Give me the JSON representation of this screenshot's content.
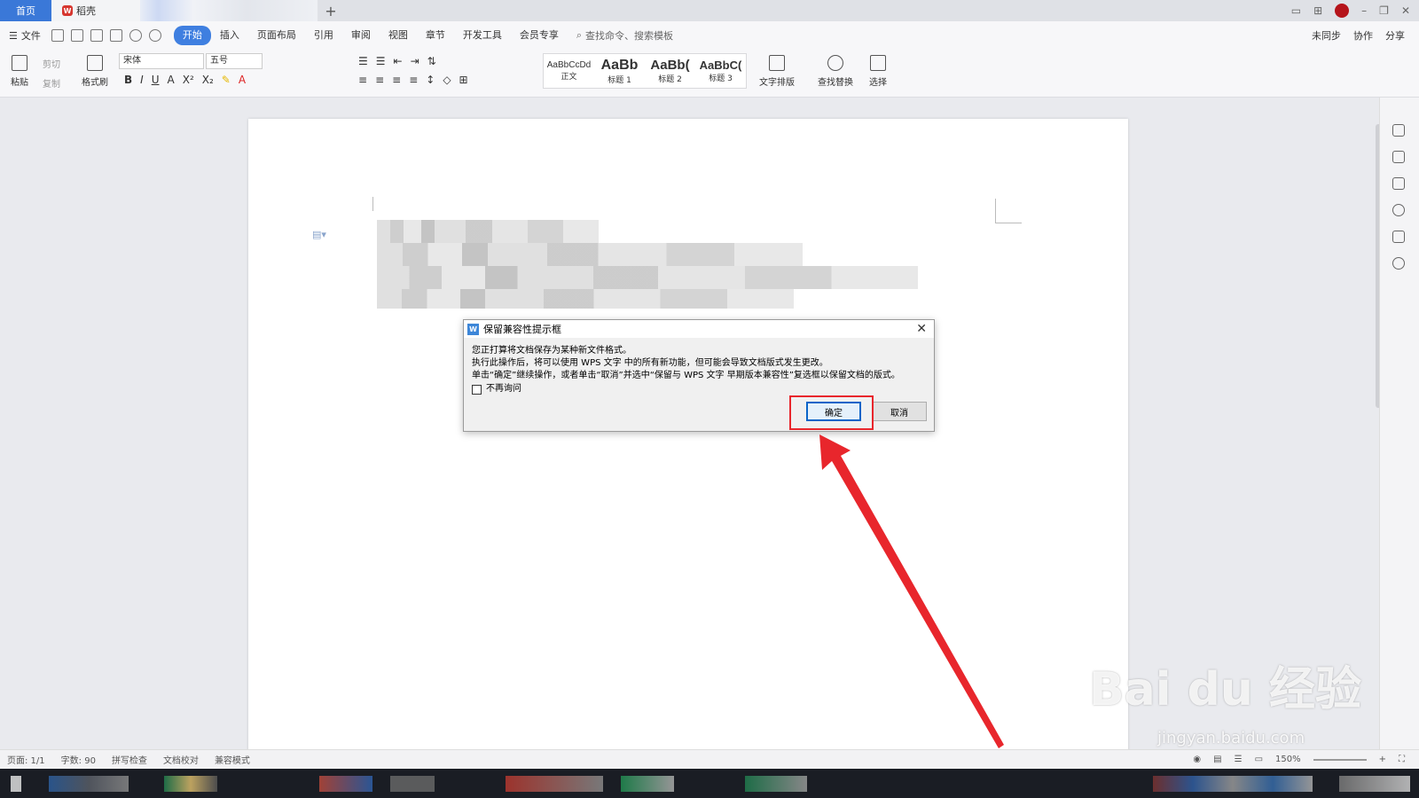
{
  "tabs": {
    "home": "首页",
    "doc": "稻壳",
    "add": "+"
  },
  "menu": {
    "file": "文件",
    "items": [
      "开始",
      "插入",
      "页面布局",
      "引用",
      "审阅",
      "视图",
      "章节",
      "开发工具",
      "会员专享"
    ],
    "active_index": 0,
    "search": "查找命令、搜索模板",
    "right": [
      "未同步",
      "协作",
      "分享"
    ]
  },
  "ribbon": {
    "paste": "粘贴",
    "cut": "剪切",
    "copy": "复制",
    "format_painter": "格式刷",
    "font_name": "宋体",
    "font_size": "五号",
    "styles": [
      {
        "preview": "AaBbCcDd",
        "label": "正文"
      },
      {
        "preview": "AaBb",
        "label": "标题 1"
      },
      {
        "preview": "AaBb(",
        "label": "标题 2"
      },
      {
        "preview": "AaBbC(",
        "label": "标题 3"
      }
    ],
    "text_layout": "文字排版",
    "find_replace": "查找替换",
    "select": "选择"
  },
  "dialog": {
    "title": "保留兼容性提示框",
    "line1": "您正打算将文档保存为某种新文件格式。",
    "line2": "执行此操作后，将可以使用 WPS 文字 中的所有新功能，但可能会导致文档版式发生更改。",
    "line3": "单击“确定”继续操作，或者单击“取消”并选中“保留与 WPS 文字 早期版本兼容性”复选框以保留文档的版式。",
    "checkbox_label": "不再询问",
    "checkbox_checked": false,
    "ok": "确定",
    "cancel": "取消"
  },
  "statusbar": {
    "page": "页面: 1/1",
    "words": "字数: 90",
    "spell": "拼写检查",
    "proof": "文档校对",
    "mode": "兼容模式",
    "zoom": "150%"
  },
  "watermark": {
    "main": "Bai du 经验",
    "sub": "jingyan.baidu.com"
  },
  "colors": {
    "accent": "#3a78d8",
    "highlight": "#e8262c",
    "ok_border": "#0a64c8"
  }
}
